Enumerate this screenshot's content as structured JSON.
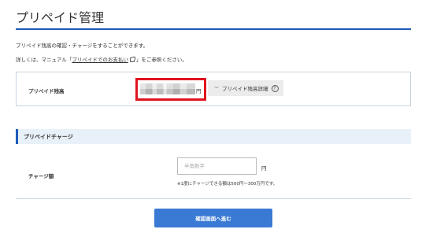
{
  "page": {
    "title": "プリペイド管理",
    "description": "プリペイド残高の確認・チャージをすることができます。",
    "details_prefix": "詳しくは、マニュアル「",
    "details_link": "プリペイドでのお支払い",
    "details_suffix": "」をご参照ください。"
  },
  "balance": {
    "label": "プリペイド残高",
    "unit": "円",
    "details_button": "プリペイド残高詳細"
  },
  "charge": {
    "section_title": "プリペイドチャージ",
    "amount_label": "チャージ額",
    "amount_placeholder": "半角数字",
    "amount_value": "",
    "unit": "円",
    "note": "※1度にチャージできる額は500円〜300万円です。",
    "confirm_button": "確認画面へ進む"
  },
  "colors": {
    "accent": "#1e5bb8",
    "button": "#3a7ad4",
    "highlight_box": "#e0141e",
    "section_bg": "#e8f0f8"
  },
  "icons": {
    "external": "external-link-icon",
    "chevron": "chevron-down-icon",
    "help": "question-circle-icon"
  }
}
